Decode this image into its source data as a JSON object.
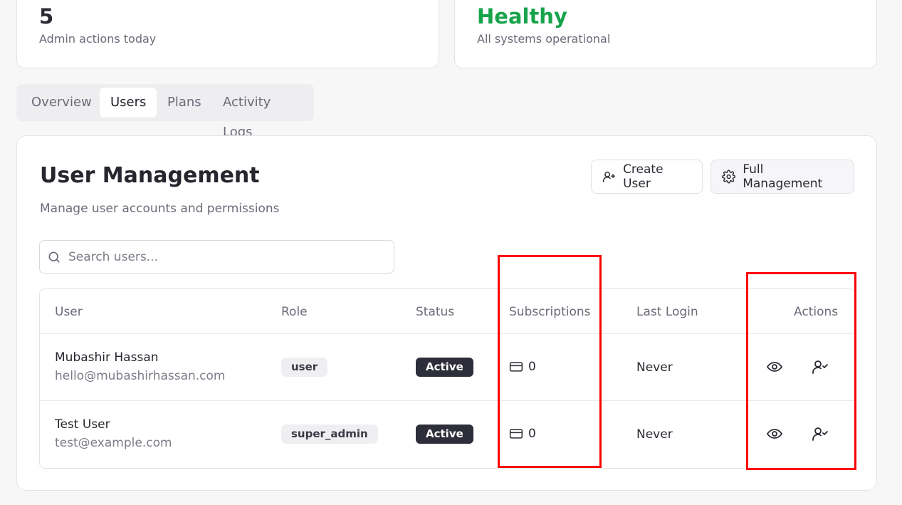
{
  "stats": {
    "admin_actions": {
      "value": "5",
      "label": "Admin actions today"
    },
    "system": {
      "value": "Healthy",
      "label": "All systems operational",
      "color": "#16a34a"
    }
  },
  "tabs": [
    {
      "label": "Overview",
      "active": false
    },
    {
      "label": "Users",
      "active": true
    },
    {
      "label": "Plans",
      "active": false
    },
    {
      "label": "Activity Logs",
      "active": false
    }
  ],
  "user_management": {
    "title": "User Management",
    "subtitle": "Manage user accounts and permissions",
    "create_button": "Create User",
    "full_button": "Full Management",
    "search_placeholder": "Search users...",
    "columns": [
      "User",
      "Role",
      "Status",
      "Subscriptions",
      "Last Login",
      "Actions"
    ],
    "rows": [
      {
        "name": "Mubashir Hassan",
        "email": "hello@mubashirhassan.com",
        "role": "user",
        "status": "Active",
        "subscriptions": "0",
        "last_login": "Never"
      },
      {
        "name": "Test User",
        "email": "test@example.com",
        "role": "super_admin",
        "status": "Active",
        "subscriptions": "0",
        "last_login": "Never"
      }
    ]
  },
  "icons": {
    "create": "user-plus-icon",
    "full": "gear-icon",
    "search": "search-icon",
    "subscriptions": "credit-card-icon",
    "view": "eye-icon",
    "impersonate": "user-check-icon"
  },
  "colors": {
    "annotation": "#ff0000",
    "status_badge": "#2e2e3a"
  }
}
